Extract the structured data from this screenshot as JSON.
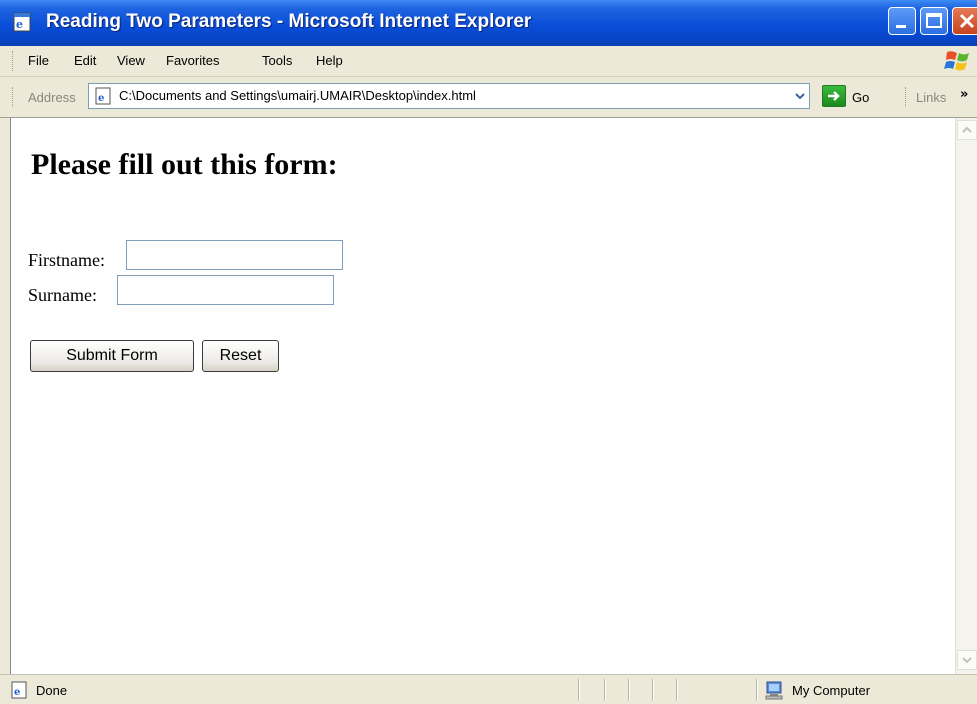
{
  "window": {
    "title": "Reading Two Parameters - Microsoft Internet Explorer",
    "controls": {
      "minimize": "minimize",
      "maximize": "maximize",
      "close": "close"
    }
  },
  "menu": {
    "items": [
      "File",
      "Edit",
      "View",
      "Favorites",
      "Tools",
      "Help"
    ]
  },
  "address_bar": {
    "label": "Address",
    "url": "C:\\Documents and Settings\\umairj.UMAIR\\Desktop\\index.html",
    "go_label": "Go",
    "links_label": "Links",
    "overflow_glyph": "»"
  },
  "page": {
    "heading": "Please fill out this form:",
    "firstname_label": "Firstname:",
    "firstname_value": "",
    "surname_label": "Surname:",
    "surname_value": "",
    "submit_label": "Submit Form",
    "reset_label": "Reset"
  },
  "status_bar": {
    "text": "Done",
    "zone": "My Computer"
  },
  "colors": {
    "titlebar": "#0a4ed8",
    "chrome": "#ece9d8",
    "close_button": "#c5431e",
    "go_button": "#1c8a1c"
  },
  "icons": [
    "ie-page-icon",
    "windows-logo-icon",
    "go-arrow-icon",
    "my-computer-icon"
  ]
}
